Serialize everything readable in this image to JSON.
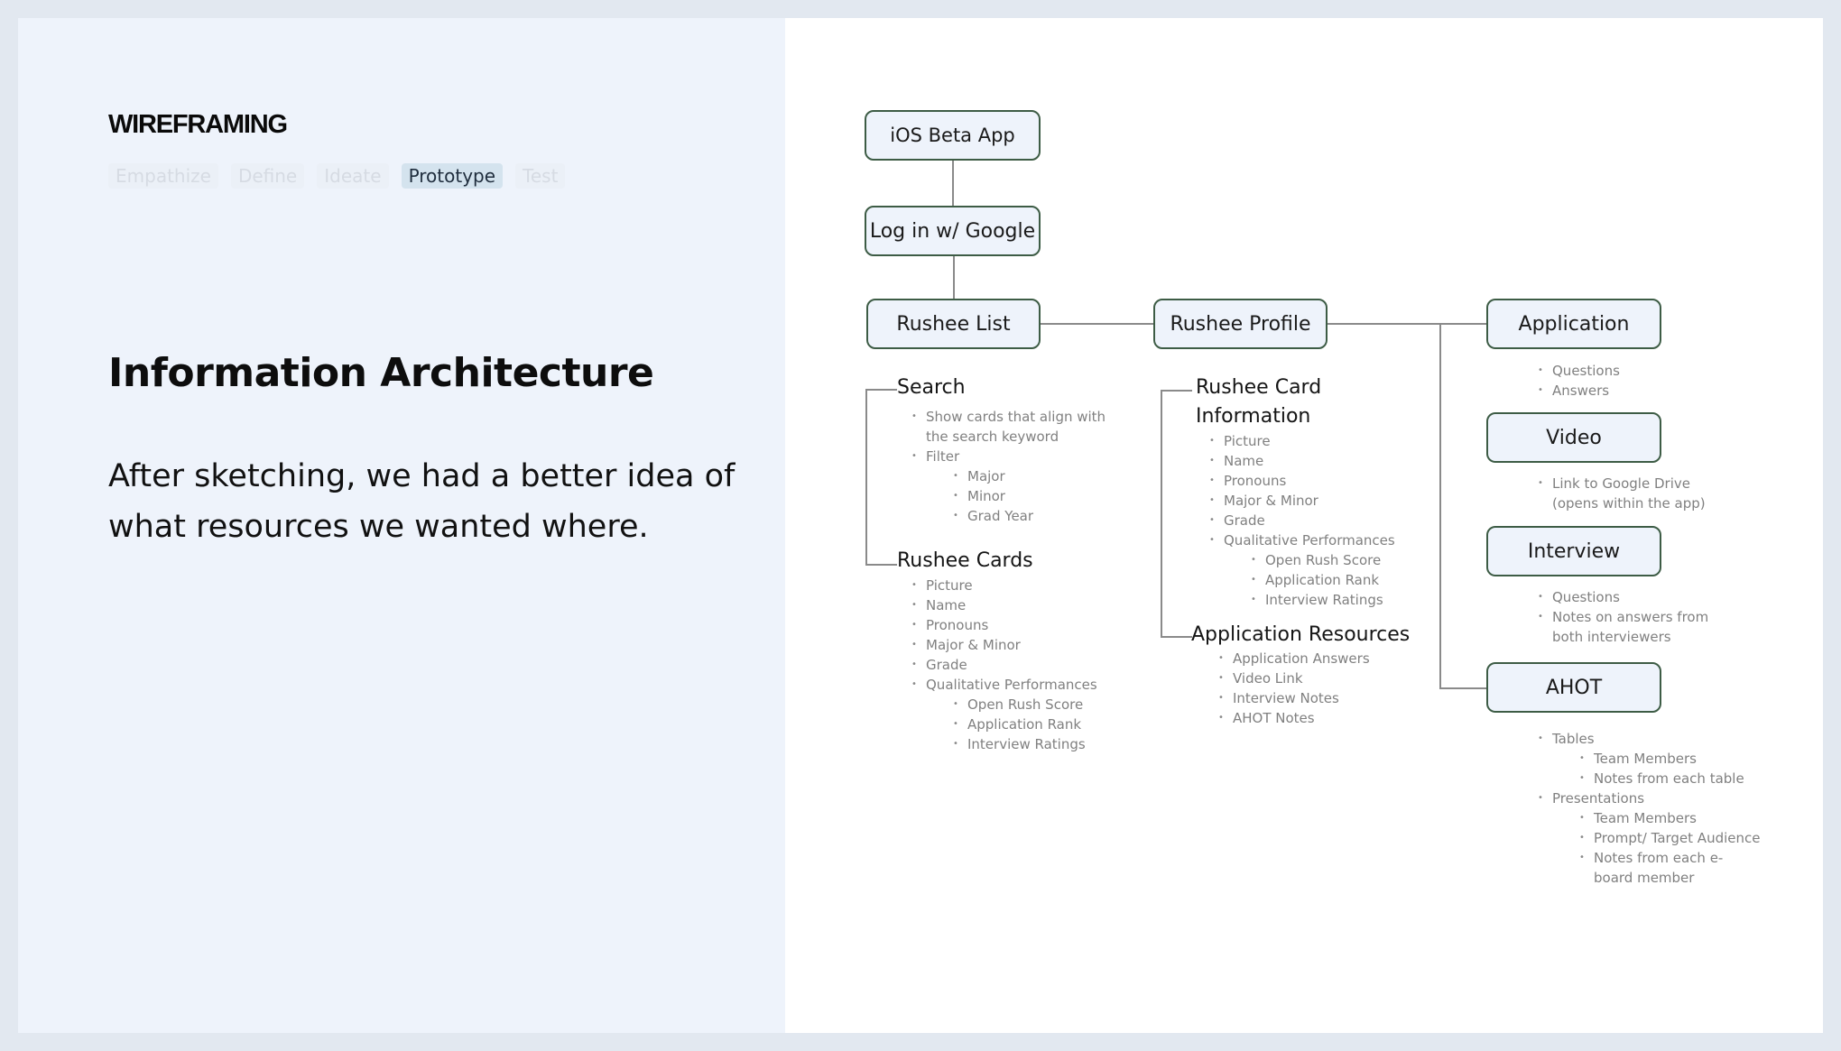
{
  "header": {
    "section_label": "WIREFRAMING",
    "steps": [
      {
        "label": "Empathize",
        "active": false
      },
      {
        "label": "Define",
        "active": false
      },
      {
        "label": "Ideate",
        "active": false
      },
      {
        "label": "Prototype",
        "active": true
      },
      {
        "label": "Test",
        "active": false
      }
    ]
  },
  "content": {
    "title": "Information Architecture",
    "description": "After sketching, we had a better idea of what resources we wanted where."
  },
  "colors": {
    "node_border": "#3d5c45",
    "node_fill": "#eef3fb",
    "connector": "#8a8a8a",
    "active_step_bg": "#d4e3ee"
  },
  "diagram": {
    "nodes": {
      "ios_beta_app": "iOS Beta App",
      "log_in_google": "Log in w/ Google",
      "rushee_list": "Rushee List",
      "rushee_profile": "Rushee Profile",
      "application": "Application",
      "video": "Video",
      "interview": "Interview",
      "ahot": "AHOT"
    },
    "rushee_list": {
      "search": {
        "heading": "Search",
        "items": [
          {
            "text": "Show cards that align with the search keyword",
            "level": 1
          },
          {
            "text": "Filter",
            "level": 1
          },
          {
            "text": "Major",
            "level": 2
          },
          {
            "text": "Minor",
            "level": 2
          },
          {
            "text": "Grad Year",
            "level": 2
          }
        ]
      },
      "cards": {
        "heading": "Rushee Cards",
        "items": [
          {
            "text": "Picture",
            "level": 1
          },
          {
            "text": "Name",
            "level": 1
          },
          {
            "text": "Pronouns",
            "level": 1
          },
          {
            "text": "Major & Minor",
            "level": 1
          },
          {
            "text": "Grade",
            "level": 1
          },
          {
            "text": "Qualitative Performances",
            "level": 1
          },
          {
            "text": "Open Rush Score",
            "level": 2
          },
          {
            "text": "Application Rank",
            "level": 2
          },
          {
            "text": "Interview Ratings",
            "level": 2
          }
        ]
      }
    },
    "rushee_profile": {
      "card_info": {
        "heading": "Rushee Card Information",
        "items": [
          {
            "text": "Picture",
            "level": 1
          },
          {
            "text": "Name",
            "level": 1
          },
          {
            "text": "Pronouns",
            "level": 1
          },
          {
            "text": "Major & Minor",
            "level": 1
          },
          {
            "text": "Grade",
            "level": 1
          },
          {
            "text": "Qualitative Performances",
            "level": 1
          },
          {
            "text": "Open Rush Score",
            "level": 2
          },
          {
            "text": "Application Rank",
            "level": 2
          },
          {
            "text": "Interview Ratings",
            "level": 2
          }
        ]
      },
      "resources": {
        "heading": "Application Resources",
        "items": [
          {
            "text": "Application Answers",
            "level": 1
          },
          {
            "text": "Video Link",
            "level": 1
          },
          {
            "text": "Interview Notes",
            "level": 1
          },
          {
            "text": "AHOT Notes",
            "level": 1
          }
        ]
      }
    },
    "application_items": [
      {
        "text": "Questions",
        "level": 1
      },
      {
        "text": "Answers",
        "level": 1
      }
    ],
    "video_items": [
      {
        "text": "Link to Google Drive (opens within the app)",
        "level": 1
      }
    ],
    "interview_items": [
      {
        "text": "Questions",
        "level": 1
      },
      {
        "text": "Notes on answers from both interviewers",
        "level": 1
      }
    ],
    "ahot_items": [
      {
        "text": "Tables",
        "level": 1
      },
      {
        "text": "Team Members",
        "level": 2
      },
      {
        "text": "Notes from each table",
        "level": 2
      },
      {
        "text": "Presentations",
        "level": 1
      },
      {
        "text": "Team Members",
        "level": 2
      },
      {
        "text": "Prompt/ Target Audience",
        "level": 2
      },
      {
        "text": "Notes from each e-board member",
        "level": 2
      }
    ]
  }
}
